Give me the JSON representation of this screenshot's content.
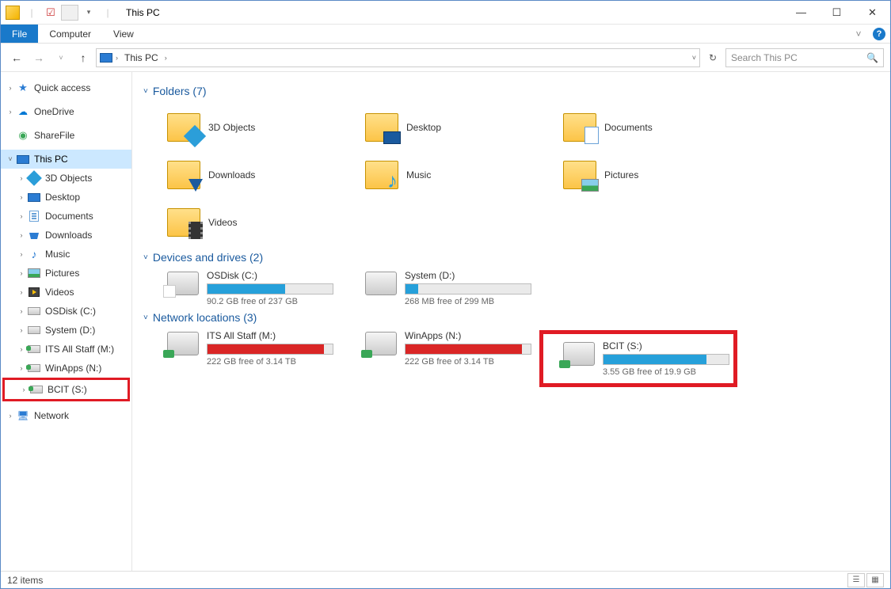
{
  "title": "This PC",
  "ribbon": {
    "file": "File",
    "computer": "Computer",
    "view": "View"
  },
  "breadcrumb": "This PC",
  "search_placeholder": "Search This PC",
  "sidebar": {
    "quick_access": "Quick access",
    "onedrive": "OneDrive",
    "sharefile": "ShareFile",
    "this_pc": "This PC",
    "children": {
      "objects3d": "3D Objects",
      "desktop": "Desktop",
      "documents": "Documents",
      "downloads": "Downloads",
      "music": "Music",
      "pictures": "Pictures",
      "videos": "Videos",
      "osdisk": "OSDisk (C:)",
      "systemd": "System (D:)",
      "itsall": "ITS All Staff (M:)",
      "winapps": "WinApps (N:)",
      "bcit": "BCIT (S:)"
    },
    "network": "Network"
  },
  "sections": {
    "folders": "Folders (7)",
    "devices": "Devices and drives (2)",
    "network": "Network locations (3)"
  },
  "folders": {
    "objects3d": "3D Objects",
    "desktop": "Desktop",
    "documents": "Documents",
    "downloads": "Downloads",
    "music": "Music",
    "pictures": "Pictures",
    "videos": "Videos"
  },
  "drives": {
    "osdisk": {
      "name": "OSDisk (C:)",
      "free": "90.2 GB free of 237 GB",
      "pct": 62,
      "color": "blue"
    },
    "systemd": {
      "name": "System (D:)",
      "free": "268 MB free of 299 MB",
      "pct": 10,
      "color": "blue"
    }
  },
  "netloc": {
    "itsall": {
      "name": "ITS All Staff (M:)",
      "free": "222 GB free of 3.14 TB",
      "pct": 93,
      "color": "red"
    },
    "winapps": {
      "name": "WinApps (N:)",
      "free": "222 GB free of 3.14 TB",
      "pct": 93,
      "color": "red"
    },
    "bcit": {
      "name": "BCIT (S:)",
      "free": "3.55 GB free of 19.9 GB",
      "pct": 82,
      "color": "blue"
    }
  },
  "status": "12 items"
}
